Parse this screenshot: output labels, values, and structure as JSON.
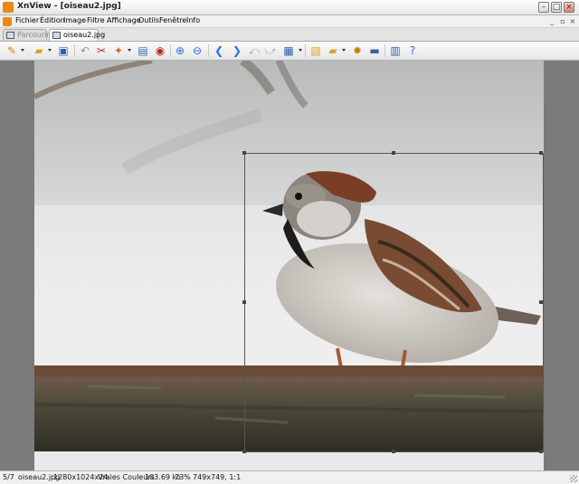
{
  "window": {
    "title": "XnView - [oiseau2.jpg]"
  },
  "menubar": {
    "items": [
      "Fichier",
      "Édition",
      "Image",
      "Filtre",
      "Affichage",
      "Outils",
      "Fenêtre",
      "Info"
    ]
  },
  "tabs": [
    {
      "label": "Parcourir"
    },
    {
      "label": "oiseau2.jpg"
    }
  ],
  "toolbar": {
    "icons": [
      "browse-icon",
      "open-folder-icon",
      "save-icon",
      "undo-icon",
      "cut-icon",
      "color-icon",
      "crop-icon",
      "redeye-icon",
      "zoom-in-icon",
      "zoom-out-icon",
      "previous-icon",
      "next-icon",
      "rotate-left-icon",
      "rotate-right-icon",
      "slideshow-icon",
      "convert-icon",
      "folder-icon",
      "settings-icon",
      "scanner-icon",
      "info-icon",
      "help-icon"
    ]
  },
  "statusbar": {
    "index": "5/7",
    "filename": "oiseau2.jpg",
    "dimensions": "1280x1024x24",
    "color_mode": "Vraies Couleurs",
    "filesize": "103.69 ko",
    "zoom": "73%",
    "selection": "749x749, 1:1"
  },
  "colors": {
    "accent": "#2a6ee0",
    "chrome": "#d4d0c8",
    "viewer_bg": "#7b7b7b"
  }
}
